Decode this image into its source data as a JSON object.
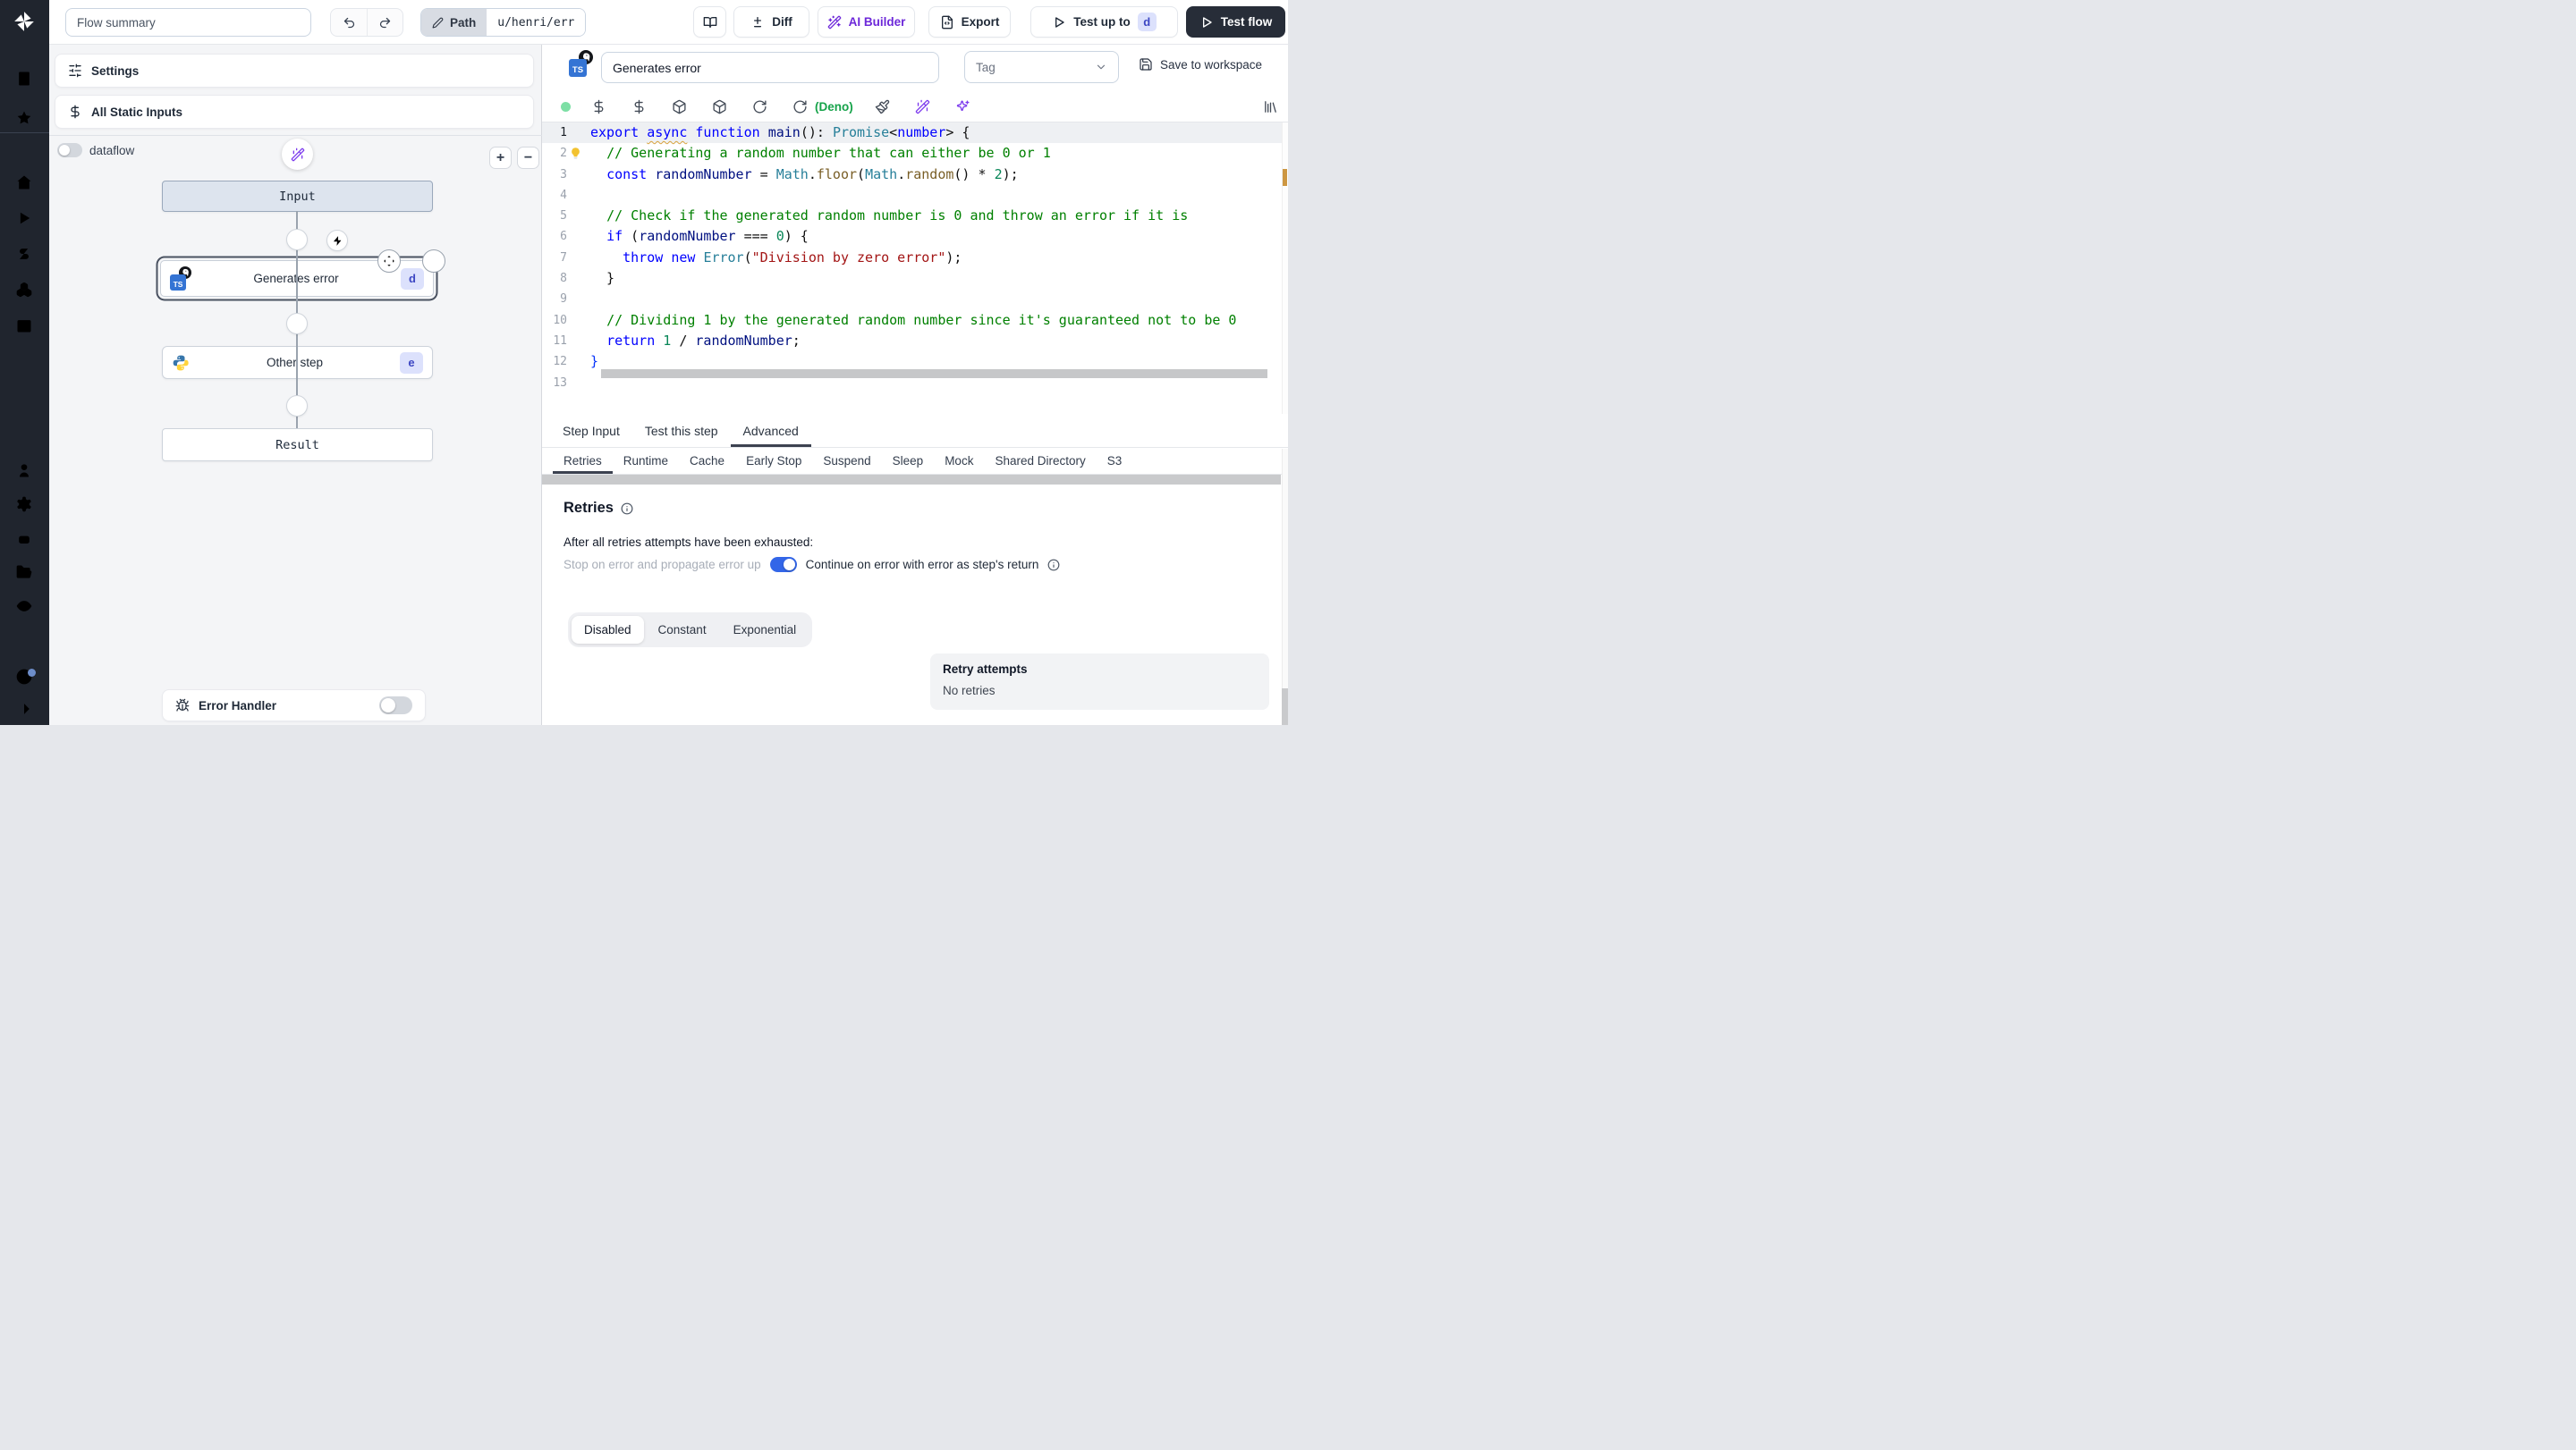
{
  "topbar": {
    "flow_summary": "Flow summary",
    "path_label": "Path",
    "path_value": "u/henri/err",
    "diff": "Diff",
    "ai_builder": "AI Builder",
    "export": "Export",
    "test_up_to": "Test up to",
    "test_up_to_badge": "d",
    "test_flow": "Test flow"
  },
  "flow_panel": {
    "settings": "Settings",
    "all_static_inputs": "All Static Inputs",
    "dataflow": "dataflow",
    "zoom_in": "+",
    "zoom_out": "−",
    "input_node": "Input",
    "result_node": "Result",
    "steps": [
      {
        "name": "Generates error",
        "badge": "d",
        "language": "typescript-deno",
        "selected": true
      },
      {
        "name": "Other step",
        "badge": "e",
        "language": "python",
        "selected": false
      }
    ],
    "error_handler": "Error Handler"
  },
  "step": {
    "name": "Generates error",
    "language_badge": "TS",
    "tag_placeholder": "Tag",
    "save_to_workspace": "Save to workspace",
    "runtime": "(Deno)",
    "tabs": [
      "Step Input",
      "Test this step",
      "Advanced"
    ],
    "active_tab": "Advanced",
    "subtabs": [
      "Retries",
      "Runtime",
      "Cache",
      "Early Stop",
      "Suspend",
      "Sleep",
      "Mock",
      "Shared Directory",
      "S3"
    ],
    "active_subtab": "Retries",
    "code": {
      "lines": [
        [
          [
            "kw",
            "export"
          ],
          [
            "pl",
            " "
          ],
          [
            "kwu",
            "async"
          ],
          [
            "pl",
            " "
          ],
          [
            "kw",
            "function"
          ],
          [
            "pl",
            " "
          ],
          [
            "id",
            "main"
          ],
          [
            "pl",
            "(): "
          ],
          [
            "type",
            "Promise"
          ],
          [
            "pl",
            "<"
          ],
          [
            "kw",
            "number"
          ],
          [
            "pl",
            "> {"
          ]
        ],
        [
          [
            "pl",
            "  "
          ],
          [
            "cm",
            "// Generating a random number that can either be 0 or 1"
          ]
        ],
        [
          [
            "pl",
            "  "
          ],
          [
            "kw",
            "const"
          ],
          [
            "pl",
            " "
          ],
          [
            "id",
            "randomNumber"
          ],
          [
            "pl",
            " = "
          ],
          [
            "type",
            "Math"
          ],
          [
            "pl",
            "."
          ],
          [
            "fn",
            "floor"
          ],
          [
            "pl",
            "("
          ],
          [
            "type",
            "Math"
          ],
          [
            "pl",
            "."
          ],
          [
            "fn",
            "random"
          ],
          [
            "pl",
            "() * "
          ],
          [
            "num",
            "2"
          ],
          [
            "pl",
            ");"
          ]
        ],
        [],
        [
          [
            "pl",
            "  "
          ],
          [
            "cm",
            "// Check if the generated random number is 0 and throw an error if it is"
          ]
        ],
        [
          [
            "pl",
            "  "
          ],
          [
            "kw",
            "if"
          ],
          [
            "pl",
            " ("
          ],
          [
            "id",
            "randomNumber"
          ],
          [
            "pl",
            " === "
          ],
          [
            "num",
            "0"
          ],
          [
            "pl",
            ") {"
          ]
        ],
        [
          [
            "pl",
            "    "
          ],
          [
            "kw",
            "throw"
          ],
          [
            "pl",
            " "
          ],
          [
            "kw",
            "new"
          ],
          [
            "pl",
            " "
          ],
          [
            "type",
            "Error"
          ],
          [
            "pl",
            "("
          ],
          [
            "str",
            "\"Division by zero error\""
          ],
          [
            "pl",
            ");"
          ]
        ],
        [
          [
            "pl",
            "  }"
          ]
        ],
        [],
        [
          [
            "pl",
            "  "
          ],
          [
            "cm",
            "// Dividing 1 by the generated random number since it's guaranteed not to be 0"
          ]
        ],
        [
          [
            "pl",
            "  "
          ],
          [
            "kw",
            "return"
          ],
          [
            "pl",
            " "
          ],
          [
            "num",
            "1"
          ],
          [
            "pl",
            " / "
          ],
          [
            "id",
            "randomNumber"
          ],
          [
            "pl",
            ";"
          ]
        ],
        [
          [
            "br",
            "}"
          ]
        ],
        []
      ]
    },
    "retries": {
      "title": "Retries",
      "exhausted_label": "After all retries attempts have been exhausted:",
      "stop_option": "Stop on error and propagate error up",
      "continue_option": "Continue on error with error as step's return",
      "continue_enabled": true,
      "modes": [
        "Disabled",
        "Constant",
        "Exponential"
      ],
      "active_mode": "Disabled",
      "attempts_title": "Retry attempts",
      "attempts_value": "No retries"
    }
  },
  "colors": {
    "toggle_on": "#3366e8",
    "ai_purple": "#7c3aed",
    "deno_green": "#16a34a",
    "badge_bg": "#dce1fc",
    "badge_text": "#3d47c3"
  }
}
